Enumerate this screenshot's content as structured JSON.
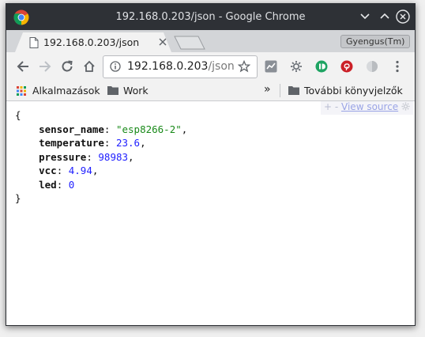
{
  "window": {
    "title": "192.168.0.203/json - Google Chrome"
  },
  "tab": {
    "title": "192.168.0.203/json"
  },
  "profile": {
    "name": "Gyengus(Tm)"
  },
  "omnibox": {
    "host": "192.168.0.203",
    "path": "/json"
  },
  "bookmarks": {
    "apps_label": "Alkalmazások",
    "work_label": "Work",
    "overflow_label": "»",
    "other_label": "További könyvjelzők"
  },
  "json_viewer": {
    "plus": "+",
    "minus": "-",
    "view_source": "View source",
    "open_brace": "{",
    "close_brace": "}",
    "fields": [
      {
        "key": "sensor_name",
        "value": "\"esp8266-2\"",
        "type": "str",
        "comma": ","
      },
      {
        "key": "temperature",
        "value": "23.6",
        "type": "num",
        "comma": ","
      },
      {
        "key": "pressure",
        "value": "98983",
        "type": "num",
        "comma": ","
      },
      {
        "key": "vcc",
        "value": "4.94",
        "type": "num",
        "comma": ","
      },
      {
        "key": "led",
        "value": "0",
        "type": "num",
        "comma": ""
      }
    ]
  },
  "colors": {
    "titlebar": "#2e3136",
    "string": "#1a8a1a",
    "number": "#1e1eff"
  }
}
